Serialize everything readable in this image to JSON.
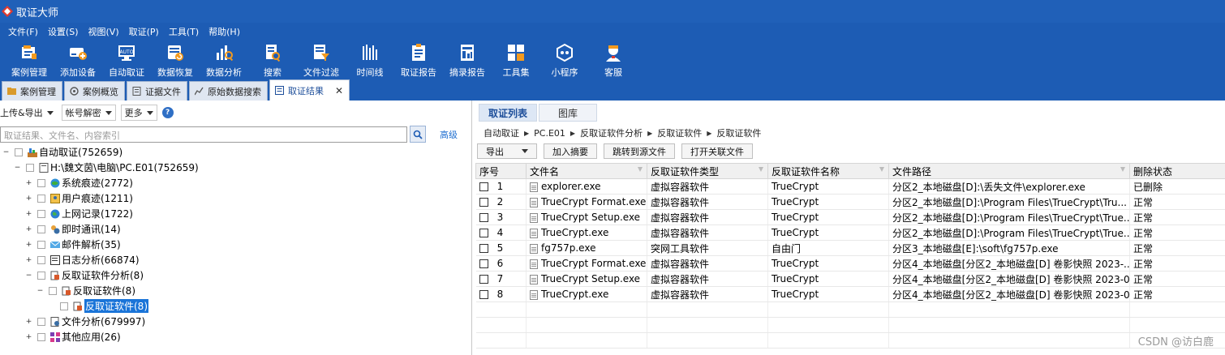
{
  "window": {
    "title": "取证大师"
  },
  "menu": [
    "文件(F)",
    "设置(S)",
    "视图(V)",
    "取证(P)",
    "工具(T)",
    "帮助(H)"
  ],
  "toolbar": [
    {
      "label": "案例管理",
      "icon": "case-management-icon"
    },
    {
      "label": "添加设备",
      "icon": "add-device-icon"
    },
    {
      "label": "自动取证",
      "icon": "auto-forensics-icon"
    },
    {
      "label": "数据恢复",
      "icon": "data-recovery-icon"
    },
    {
      "label": "数据分析",
      "icon": "data-analysis-icon"
    },
    {
      "label": "搜索",
      "icon": "search-icon"
    },
    {
      "label": "文件过滤",
      "icon": "file-filter-icon"
    },
    {
      "label": "时间线",
      "icon": "timeline-icon"
    },
    {
      "label": "取证报告",
      "icon": "forensic-report-icon"
    },
    {
      "label": "摘录报告",
      "icon": "excerpt-report-icon"
    },
    {
      "label": "工具集",
      "icon": "toolset-icon"
    },
    {
      "label": "小程序",
      "icon": "mini-program-icon"
    },
    {
      "label": "客服",
      "icon": "customer-service-icon"
    }
  ],
  "doc_tabs": [
    {
      "label": "案例管理"
    },
    {
      "label": "案例概览"
    },
    {
      "label": "证据文件"
    },
    {
      "label": "原始数据搜索"
    },
    {
      "label": "取证结果",
      "active": true
    }
  ],
  "left": {
    "upload_export": "上传&导出",
    "account_decrypt": "帐号解密",
    "more": "更多",
    "help": "?",
    "search_placeholder": "取证结果、文件名、内容索引",
    "advanced": "高级",
    "tree": [
      {
        "label": "自动取证(752659)",
        "level": 0,
        "exp": "−",
        "icon": "auto-forensics-icon"
      },
      {
        "label": "H:\\魏文茵\\电脑\\PC.E01(752659)",
        "level": 1,
        "exp": "−",
        "icon": "disk-image-icon"
      },
      {
        "label": "系统痕迹(2772)",
        "level": 2,
        "exp": "+",
        "icon": "system-traces-icon"
      },
      {
        "label": "用户痕迹(1211)",
        "level": 2,
        "exp": "+",
        "icon": "user-traces-icon"
      },
      {
        "label": "上网记录(1722)",
        "level": 2,
        "exp": "+",
        "icon": "internet-records-icon"
      },
      {
        "label": "即时通讯(14)",
        "level": 2,
        "exp": "+",
        "icon": "instant-messaging-icon"
      },
      {
        "label": "邮件解析(35)",
        "level": 2,
        "exp": "+",
        "icon": "email-parsing-icon"
      },
      {
        "label": "日志分析(66874)",
        "level": 2,
        "exp": "+",
        "icon": "log-analysis-icon"
      },
      {
        "label": "反取证软件分析(8)",
        "level": 2,
        "exp": "−",
        "icon": "anti-forensics-icon"
      },
      {
        "label": "反取证软件(8)",
        "level": 3,
        "exp": "−",
        "icon": "anti-forensics-icon"
      },
      {
        "label": "反取证软件(8)",
        "level": 4,
        "exp": "",
        "icon": "anti-forensics-icon",
        "selected": true
      },
      {
        "label": "文件分析(679997)",
        "level": 2,
        "exp": "+",
        "icon": "file-analysis-icon"
      },
      {
        "label": "其他应用(26)",
        "level": 2,
        "exp": "+",
        "icon": "other-apps-icon"
      }
    ]
  },
  "right": {
    "tabs": [
      {
        "label": "取证列表",
        "active": true
      },
      {
        "label": "图库"
      }
    ],
    "breadcrumb": [
      "自动取证",
      "PC.E01",
      "反取证软件分析",
      "反取证软件",
      "反取证软件"
    ],
    "actions": {
      "export": "导出",
      "add_summary": "加入摘要",
      "jump_source": "跳转到源文件",
      "open_related": "打开关联文件"
    },
    "columns": [
      "序号",
      "文件名",
      "反取证软件类型",
      "反取证软件名称",
      "文件路径",
      "删除状态"
    ],
    "rows": [
      {
        "no": "1",
        "name": "explorer.exe",
        "type": "虚拟容器软件",
        "soft": "TrueCrypt",
        "path": "分区2_本地磁盘[D]:\\丢失文件\\explorer.exe",
        "status": "已删除"
      },
      {
        "no": "2",
        "name": "TrueCrypt Format.exe",
        "type": "虚拟容器软件",
        "soft": "TrueCrypt",
        "path": "分区2_本地磁盘[D]:\\Program Files\\TrueCrypt\\Tru...",
        "status": "正常"
      },
      {
        "no": "3",
        "name": "TrueCrypt Setup.exe",
        "type": "虚拟容器软件",
        "soft": "TrueCrypt",
        "path": "分区2_本地磁盘[D]:\\Program Files\\TrueCrypt\\True...",
        "status": "正常"
      },
      {
        "no": "4",
        "name": "TrueCrypt.exe",
        "type": "虚拟容器软件",
        "soft": "TrueCrypt",
        "path": "分区2_本地磁盘[D]:\\Program Files\\TrueCrypt\\True...",
        "status": "正常"
      },
      {
        "no": "5",
        "name": "fg757p.exe",
        "type": "突网工具软件",
        "soft": "自由门",
        "path": "分区3_本地磁盘[E]:\\soft\\fg757p.exe",
        "status": "正常"
      },
      {
        "no": "6",
        "name": "TrueCrypt Format.exe",
        "type": "虚拟容器软件",
        "soft": "TrueCrypt",
        "path": "分区4_本地磁盘[分区2_本地磁盘[D] 卷影快照 2023-...",
        "status": "正常"
      },
      {
        "no": "7",
        "name": "TrueCrypt Setup.exe",
        "type": "虚拟容器软件",
        "soft": "TrueCrypt",
        "path": "分区4_本地磁盘[分区2_本地磁盘[D] 卷影快照 2023-0...",
        "status": "正常"
      },
      {
        "no": "8",
        "name": "TrueCrypt.exe",
        "type": "虚拟容器软件",
        "soft": "TrueCrypt",
        "path": "分区4_本地磁盘[分区2_本地磁盘[D] 卷影快照 2023-0...",
        "status": "正常"
      }
    ]
  },
  "watermark": "CSDN @访白鹿",
  "colors": {
    "titlebar": "#2060b8",
    "toolbar": "#1d5cb4",
    "selection": "#1a74d8",
    "link": "#1f6fd0"
  }
}
